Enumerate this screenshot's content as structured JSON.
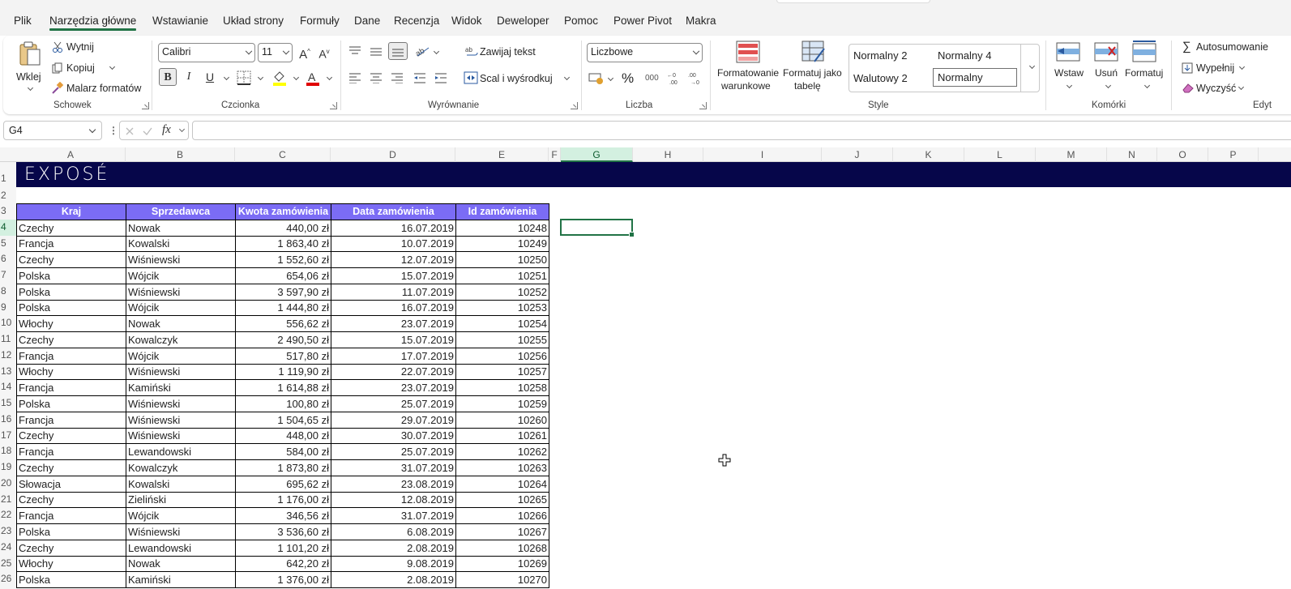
{
  "menu": {
    "tabs": [
      "Plik",
      "Narzędzia główne",
      "Wstawianie",
      "Układ strony",
      "Formuły",
      "Dane",
      "Recenzja",
      "Widok",
      "Deweloper",
      "Pomoc",
      "Power Pivot",
      "Makra"
    ],
    "active": "Narzędzia główne"
  },
  "ribbon": {
    "clipboard": {
      "paste": "Wklej",
      "cut": "Wytnij",
      "copy": "Kopiuj",
      "painter": "Malarz formatów",
      "label": "Schowek"
    },
    "font": {
      "family": "Calibri",
      "size": "11",
      "label": "Czcionka",
      "bold": "B",
      "italic": "I",
      "underline": "U"
    },
    "alignment": {
      "wrap": "Zawijaj tekst",
      "merge": "Scal i wyśrodkuj",
      "label": "Wyrównanie"
    },
    "number": {
      "format": "Liczbowe",
      "percent": "%",
      "thousands": "000",
      "label": "Liczba"
    },
    "styles": {
      "conditional": [
        "Formatowanie",
        "warunkowe"
      ],
      "as_table": [
        "Formatuj jako",
        "tabelę"
      ],
      "cells": [
        "Normalny 2",
        "Normalny 4",
        "Walutowy 2",
        "Normalny"
      ],
      "label": "Style"
    },
    "cells": {
      "insert": "Wstaw",
      "delete": "Usuń",
      "format": "Formatuj",
      "label": "Komórki"
    },
    "editing": {
      "autosum": "Autosumowanie",
      "fill": "Wypełnij",
      "clear": "Wyczyść",
      "label": "Edyt"
    }
  },
  "formula_bar": {
    "name_box": "G4",
    "fx": "fx",
    "formula": ""
  },
  "grid": {
    "columns": [
      "A",
      "B",
      "C",
      "D",
      "E",
      "F",
      "G",
      "H",
      "I",
      "J",
      "K",
      "L",
      "M",
      "N",
      "O",
      "P"
    ],
    "selected_column": "G",
    "selected_row": "4",
    "rows": [
      "1",
      "2",
      "3",
      "4",
      "5",
      "6",
      "7",
      "8",
      "9",
      "10",
      "11",
      "12",
      "13",
      "14",
      "15",
      "16",
      "17",
      "18",
      "19",
      "20",
      "21",
      "22",
      "23",
      "24",
      "25",
      "26"
    ],
    "banner_text": "EXPOSÉ"
  },
  "table": {
    "headers": [
      "Kraj",
      "Sprzedawca",
      "Kwota zamówienia",
      "Data zamówienia",
      "Id zamówienia"
    ],
    "rows": [
      [
        "Czechy",
        "Nowak",
        "440,00 zł",
        "16.07.2019",
        "10248"
      ],
      [
        "Francja",
        "Kowalski",
        "1 863,40 zł",
        "10.07.2019",
        "10249"
      ],
      [
        "Czechy",
        "Wiśniewski",
        "1 552,60 zł",
        "12.07.2019",
        "10250"
      ],
      [
        "Polska",
        "Wójcik",
        "654,06 zł",
        "15.07.2019",
        "10251"
      ],
      [
        "Polska",
        "Wiśniewski",
        "3 597,90 zł",
        "11.07.2019",
        "10252"
      ],
      [
        "Polska",
        "Wójcik",
        "1 444,80 zł",
        "16.07.2019",
        "10253"
      ],
      [
        "Włochy",
        "Nowak",
        "556,62 zł",
        "23.07.2019",
        "10254"
      ],
      [
        "Czechy",
        "Kowalczyk",
        "2 490,50 zł",
        "15.07.2019",
        "10255"
      ],
      [
        "Francja",
        "Wójcik",
        "517,80 zł",
        "17.07.2019",
        "10256"
      ],
      [
        "Włochy",
        "Wiśniewski",
        "1 119,90 zł",
        "22.07.2019",
        "10257"
      ],
      [
        "Francja",
        "Kamiński",
        "1 614,88 zł",
        "23.07.2019",
        "10258"
      ],
      [
        "Polska",
        "Wiśniewski",
        "100,80 zł",
        "25.07.2019",
        "10259"
      ],
      [
        "Francja",
        "Wiśniewski",
        "1 504,65 zł",
        "29.07.2019",
        "10260"
      ],
      [
        "Czechy",
        "Wiśniewski",
        "448,00 zł",
        "30.07.2019",
        "10261"
      ],
      [
        "Francja",
        "Lewandowski",
        "584,00 zł",
        "25.07.2019",
        "10262"
      ],
      [
        "Czechy",
        "Kowalczyk",
        "1 873,80 zł",
        "31.07.2019",
        "10263"
      ],
      [
        "Słowacja",
        "Kowalski",
        "695,62 zł",
        "23.08.2019",
        "10264"
      ],
      [
        "Czechy",
        "Zieliński",
        "1 176,00 zł",
        "12.08.2019",
        "10265"
      ],
      [
        "Francja",
        "Wójcik",
        "346,56 zł",
        "31.07.2019",
        "10266"
      ],
      [
        "Polska",
        "Wiśniewski",
        "3 536,60 zł",
        "6.08.2019",
        "10267"
      ],
      [
        "Czechy",
        "Lewandowski",
        "1 101,20 zł",
        "2.08.2019",
        "10268"
      ],
      [
        "Włochy",
        "Nowak",
        "642,20 zł",
        "9.08.2019",
        "10269"
      ],
      [
        "Polska",
        "Kamiński",
        "1 376,00 zł",
        "2.08.2019",
        "10270"
      ]
    ]
  },
  "colors": {
    "accent": "#217346",
    "banner": "#06064a",
    "header_fill": "#7b6cf5"
  }
}
